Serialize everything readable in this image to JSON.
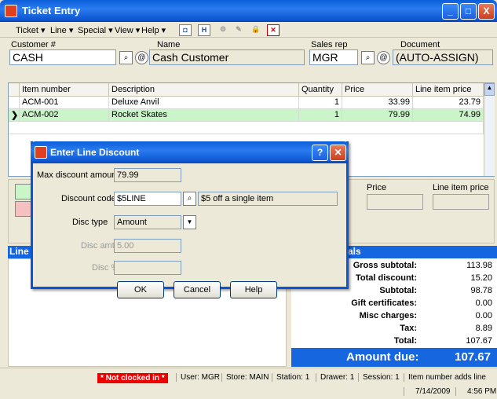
{
  "window": {
    "title": "Ticket Entry",
    "min": "_",
    "max": "□",
    "close": "X"
  },
  "menu": [
    "Ticket ▾",
    "Line ▾",
    "Special ▾",
    "View ▾",
    "Help ▾"
  ],
  "header": {
    "customer_label": "Customer #",
    "customer_value": "CASH",
    "name_label": "Name",
    "name_value": "Cash Customer",
    "salesrep_label": "Sales rep",
    "salesrep_value": "MGR",
    "document_label": "Document",
    "document_value": "(AUTO-ASSIGN)"
  },
  "grid": {
    "columns": [
      "Item number",
      "Description",
      "Quantity",
      "Price",
      "Line item price"
    ],
    "rows": [
      {
        "item": "ACM-001",
        "desc": "Deluxe Anvil",
        "qty": "1",
        "price": "33.99",
        "line": "23.79"
      },
      {
        "item": "ACM-002",
        "desc": "Rocket Skates",
        "qty": "1",
        "price": "79.99",
        "line": "74.99"
      }
    ]
  },
  "background": {
    "price_label": "Price",
    "line_item_price_label": "Line item price",
    "line_panel_label": "Line",
    "totals_header": "als"
  },
  "dialog": {
    "title": "Enter Line Discount",
    "max_discount_label": "Max discount amount",
    "max_discount_value": "79.99",
    "discount_code_label": "Discount code",
    "discount_code_value": "$5LINE",
    "discount_code_desc": "$5 off a single item",
    "disc_type_label": "Disc type",
    "disc_type_value": "Amount",
    "disc_amt_label": "Disc amt",
    "disc_amt_value": "5.00",
    "disc_pct_label": "Disc %",
    "disc_pct_value": "",
    "ok": "OK",
    "cancel": "Cancel",
    "help": "Help"
  },
  "totals": [
    {
      "label": "Gross subtotal:",
      "value": "113.98"
    },
    {
      "label": "Total discount:",
      "value": "15.20"
    },
    {
      "label": "Subtotal:",
      "value": "98.78"
    },
    {
      "label": "Gift certificates:",
      "value": "0.00"
    },
    {
      "label": "Misc charges:",
      "value": "0.00"
    },
    {
      "label": "Tax:",
      "value": "8.89"
    },
    {
      "label": "Total:",
      "value": "107.67"
    }
  ],
  "amount_due": {
    "label": "Amount due:",
    "value": "107.67"
  },
  "status": {
    "clock": "* Not clocked in *",
    "user": "User: MGR",
    "store": "Store: MAIN",
    "station": "Station: 1",
    "drawer": "Drawer: 1",
    "session": "Session: 1",
    "mode": "Item number adds line",
    "date": "7/14/2009",
    "time": "4:56 PM"
  }
}
